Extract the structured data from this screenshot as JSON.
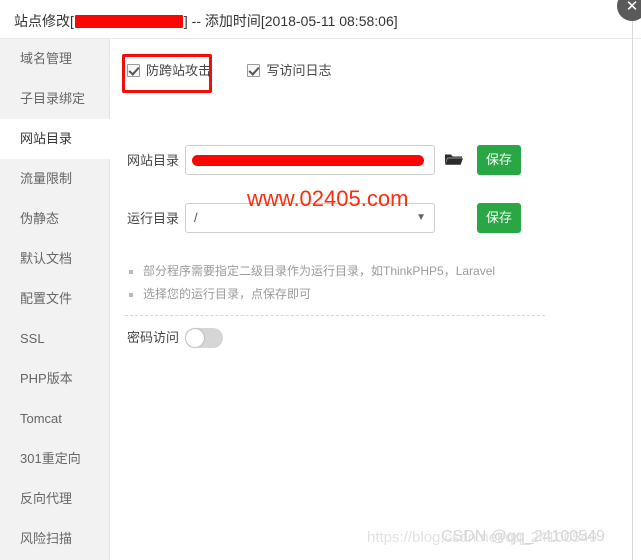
{
  "window": {
    "title_prefix": "站点修改[",
    "title_redacted": "",
    "title_suffix": "] -- 添加时间[2018-05-11 08:58:06]",
    "close_label": "✕",
    "close_icon": "close-icon"
  },
  "sidebar": {
    "items": [
      {
        "label": "域名管理",
        "active": false
      },
      {
        "label": "子目录绑定",
        "active": false
      },
      {
        "label": "网站目录",
        "active": true
      },
      {
        "label": "流量限制",
        "active": false
      },
      {
        "label": "伪静态",
        "active": false
      },
      {
        "label": "默认文档",
        "active": false
      },
      {
        "label": "配置文件",
        "active": false
      },
      {
        "label": "SSL",
        "active": false
      },
      {
        "label": "PHP版本",
        "active": false
      },
      {
        "label": "Tomcat",
        "active": false
      },
      {
        "label": "301重定向",
        "active": false
      },
      {
        "label": "反向代理",
        "active": false
      },
      {
        "label": "风险扫描",
        "active": false
      }
    ]
  },
  "main": {
    "checkboxes": [
      {
        "label": "防跨站攻击",
        "checked": true,
        "highlighted": true
      },
      {
        "label": "写访问日志",
        "checked": true,
        "highlighted": false
      }
    ],
    "dir_row": {
      "label": "网站目录",
      "value": "",
      "placeholder": "",
      "browse_icon": "folder-icon",
      "save_label": "保存"
    },
    "run_row": {
      "label": "运行目录",
      "value": "/",
      "options": [
        "/"
      ],
      "caret_icon": "chevron-down-icon",
      "save_label": "保存"
    },
    "hints": [
      "部分程序需要指定二级目录作为运行目录，如ThinkPHP5，Laravel",
      "选择您的运行目录，点保存即可"
    ],
    "password_row": {
      "label": "密码访问",
      "toggle_on": false
    }
  },
  "watermarks": {
    "red_site": "www.02405.com",
    "csdn_url": "https://blog.csdn.net/qq_24100549",
    "csdn_handle": "CSDN @qq_24100549"
  },
  "colors": {
    "save_green": "#29a745",
    "annotation_red": "#f40b0b",
    "redaction_red": "#fb0505",
    "sidebar_bg": "#f2f2f2"
  }
}
